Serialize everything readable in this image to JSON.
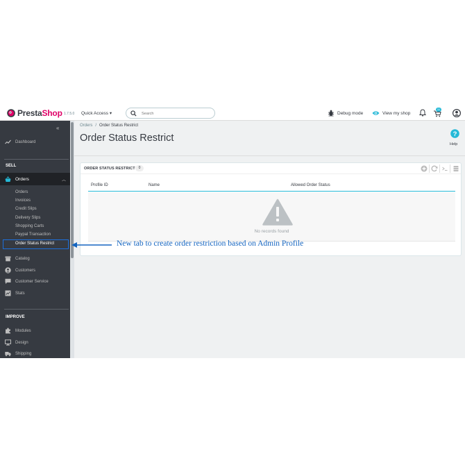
{
  "header": {
    "logo_text_a": "Presta",
    "logo_text_b": "Shop",
    "version": "1.7.5.0",
    "quick_access": "Quick Access ▾",
    "search_placeholder": "Search",
    "debug_mode": "Debug mode",
    "view_shop": "View my shop",
    "cart_badge": "11"
  },
  "sidebar": {
    "collapse": "«",
    "dashboard": "Dashboard",
    "sell_title": "SELL",
    "orders": "Orders",
    "orders_sub": [
      "Orders",
      "Invoices",
      "Credit Slips",
      "Delivery Slips",
      "Shopping Carts",
      "Paypal Transaction"
    ],
    "order_status_restrict": "Order Status Restrict",
    "catalog": "Catalog",
    "customers": "Customers",
    "customer_service": "Customer Service",
    "stats": "Stats",
    "improve_title": "IMPROVE",
    "modules": "Modules",
    "design": "Design",
    "shipping": "Shipping"
  },
  "main": {
    "breadcrumb_root": "Orders",
    "breadcrumb_sep": "/",
    "breadcrumb_current": "Order Status Restrict",
    "title": "Order Status Restrict",
    "help": "Help"
  },
  "panel": {
    "title": "ORDER STATUS RESTRICT",
    "count": "0",
    "columns": [
      "Profile ID",
      "Name",
      "Allowed Order Status"
    ],
    "empty_text": "No records found"
  },
  "annotation": {
    "text": "New tab to create order restriction based on Admin Profile",
    "color": "#1565c0"
  },
  "colors": {
    "sidebar_bg": "#363a41",
    "accent": "#25b9d7",
    "brand_pink": "#df0067"
  }
}
